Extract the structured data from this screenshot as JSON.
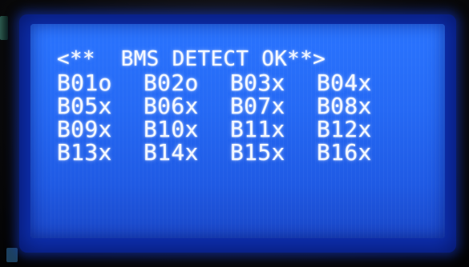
{
  "display": {
    "header": "<**  BMS DETECT OK**>",
    "rows": [
      [
        "B01o",
        "B02o",
        "B03x",
        "B04x"
      ],
      [
        "B05x",
        "B06x",
        "B07x",
        "B08x"
      ],
      [
        "B09x",
        "B10x",
        "B11x",
        "B12x"
      ],
      [
        "B13x",
        "B14x",
        "B15x",
        "B16x"
      ]
    ]
  },
  "colors": {
    "backlight": "#2569f4",
    "text": "#f4f8ff",
    "bezel": "#0a0a0c"
  }
}
